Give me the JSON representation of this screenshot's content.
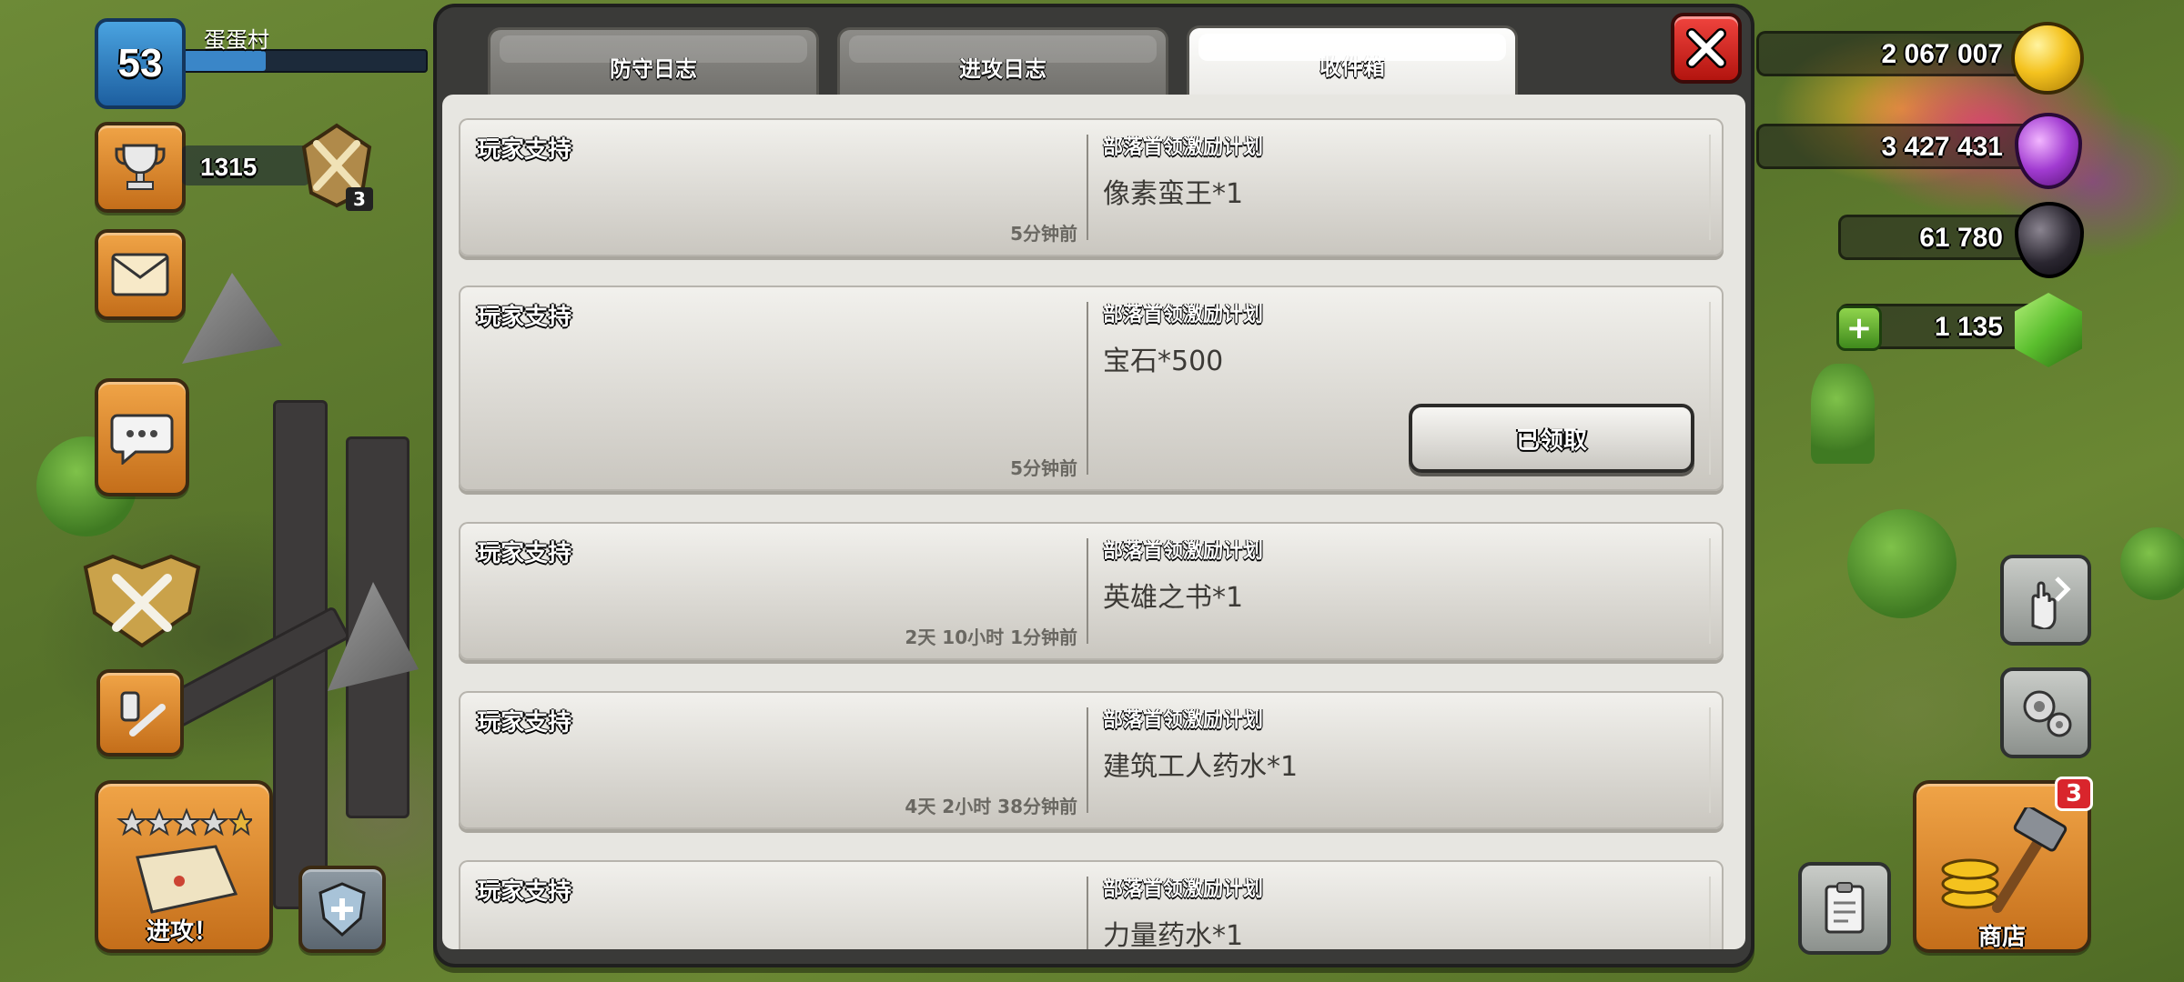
{
  "hud": {
    "level": "53",
    "player_name": "蛋蛋村",
    "trophies": "1315",
    "league_count": "3",
    "attack_label": "进攻！",
    "shop_label": "商店",
    "shop_badge": "3"
  },
  "resources": {
    "gold": "2 067 007",
    "elixir": "3 427 431",
    "dark_elixir": "61 780",
    "gems": "1 135"
  },
  "tabs": [
    {
      "label": "防守日志",
      "active": false
    },
    {
      "label": "进攻日志",
      "active": false
    },
    {
      "label": "收件箱",
      "active": true
    }
  ],
  "close_label": "X",
  "messages": [
    {
      "sender": "玩家支持",
      "time": "5分钟前",
      "program": "部落首领激励计划",
      "reward": "像素蛮王*1"
    },
    {
      "sender": "玩家支持",
      "time": "5分钟前",
      "program": "部落首领激励计划",
      "reward": "宝石*500",
      "button": "已领取"
    },
    {
      "sender": "玩家支持",
      "time": "2天 10小时 1分钟前",
      "program": "部落首领激励计划",
      "reward": "英雄之书*1"
    },
    {
      "sender": "玩家支持",
      "time": "4天 2小时 38分钟前",
      "program": "部落首领激励计划",
      "reward": "建筑工人药水*1"
    },
    {
      "sender": "玩家支持",
      "program": "部落首领激励计划",
      "reward": "力量药水*1"
    }
  ],
  "colors": {
    "modal_frame": "#3a3a38",
    "content_bg": "#e7e6e1",
    "close_red": "#d9252c",
    "gold": "#f4c21e",
    "elixir": "#a13bd1",
    "dark_elixir": "#2a2630",
    "gem": "#5bbf2e"
  }
}
